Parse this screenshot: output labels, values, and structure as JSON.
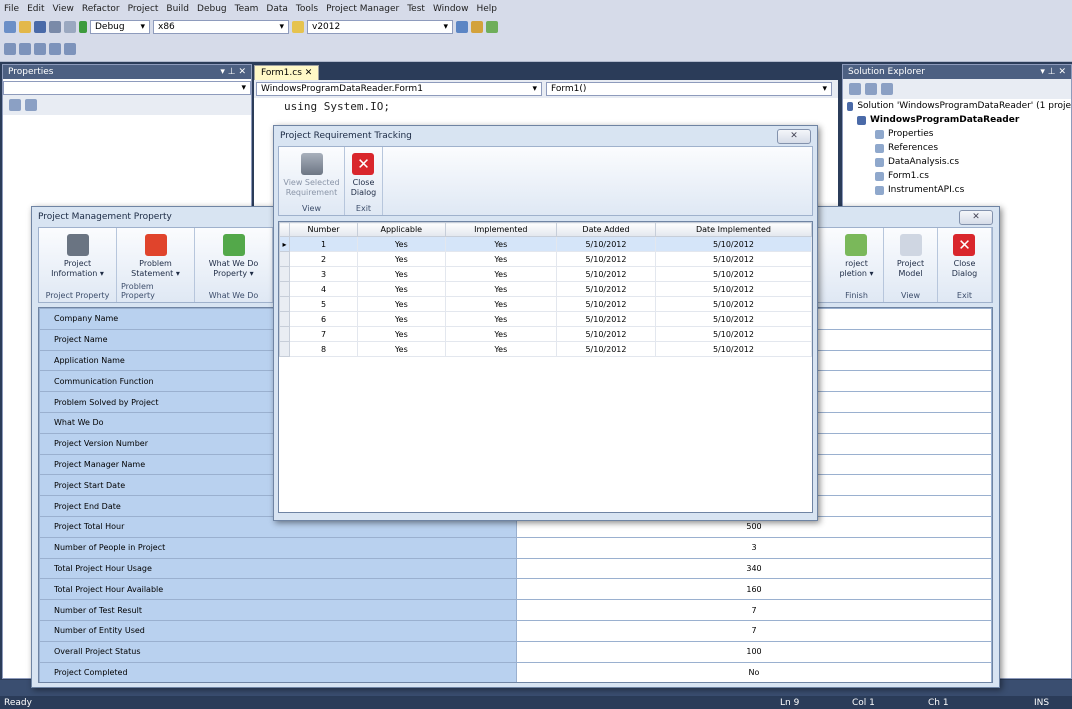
{
  "ide": {
    "menu": [
      "File",
      "Edit",
      "View",
      "Refactor",
      "Project",
      "Build",
      "Debug",
      "Team",
      "Data",
      "Tools",
      "Project Manager",
      "Test",
      "Window",
      "Help"
    ],
    "config": "Debug",
    "platform": "x86",
    "search": "v2012",
    "properties_title": "Properties",
    "editor_tab": "Form1.cs",
    "class_dropdown": "WindowsProgramDataReader.Form1",
    "member_dropdown": "Form1()",
    "code_line": "using System.IO;",
    "solution_explorer_title": "Solution Explorer",
    "solution_tree": [
      "Solution 'WindowsProgramDataReader' (1 proje",
      "WindowsProgramDataReader",
      "Properties",
      "References",
      "DataAnalysis.cs",
      "Form1.cs",
      "InstrumentAPI.cs"
    ],
    "status": {
      "ready": "Ready",
      "ln": "Ln 9",
      "col": "Col 1",
      "ch": "Ch 1",
      "ins": "INS"
    }
  },
  "pm_dialog": {
    "title": "Project Management Property",
    "ribbon_left": [
      {
        "label1": "Project",
        "label2": "Information ▾",
        "group": "Project Property",
        "color": "#6a7482"
      },
      {
        "label1": "Problem",
        "label2": "Statement ▾",
        "group": "Problem Property",
        "color": "#e0442c"
      },
      {
        "label1": "What We Do",
        "label2": "Property ▾",
        "group": "What We Do",
        "color": "#53a84a"
      }
    ],
    "ribbon_right": [
      {
        "label1": "roject",
        "label2": "pletion ▾",
        "group": "Finish"
      },
      {
        "label1": "Project",
        "label2": "Model",
        "group": "View"
      },
      {
        "label1": "Close",
        "label2": "Dialog",
        "group": "Exit"
      }
    ],
    "rows": [
      {
        "label": "Company Name",
        "value": ""
      },
      {
        "label": "Project Name",
        "value": ""
      },
      {
        "label": "Application Name",
        "value": ""
      },
      {
        "label": "Communication Function",
        "value": ""
      },
      {
        "label": "Problem Solved by Project",
        "value": ""
      },
      {
        "label": "What We Do",
        "value": ""
      },
      {
        "label": "Project Version Number",
        "value": ""
      },
      {
        "label": "Project Manager Name",
        "value": ""
      },
      {
        "label": "Project Start Date",
        "value": ""
      },
      {
        "label": "Project End Date",
        "value": ""
      },
      {
        "label": "Project Total Hour",
        "value": "500"
      },
      {
        "label": "Number of People in Project",
        "value": "3"
      },
      {
        "label": "Total Project Hour Usage",
        "value": "340"
      },
      {
        "label": "Total Project Hour Available",
        "value": "160"
      },
      {
        "label": "Number of Test Result",
        "value": "7"
      },
      {
        "label": "Number of Entity Used",
        "value": "7"
      },
      {
        "label": "Overall Project Status",
        "value": "100"
      },
      {
        "label": "Project Completed",
        "value": "No"
      }
    ]
  },
  "req_dialog": {
    "title": "Project Requirement Tracking",
    "ribbon": [
      {
        "label1": "View Selected",
        "label2": "Requirement",
        "group": "View"
      },
      {
        "label1": "Close",
        "label2": "Dialog",
        "group": "Exit"
      }
    ],
    "columns": [
      "Number",
      "Applicable",
      "Implemented",
      "Date Added",
      "Date Implemented"
    ],
    "rows": [
      [
        "1",
        "Yes",
        "Yes",
        "5/10/2012",
        "5/10/2012"
      ],
      [
        "2",
        "Yes",
        "Yes",
        "5/10/2012",
        "5/10/2012"
      ],
      [
        "3",
        "Yes",
        "Yes",
        "5/10/2012",
        "5/10/2012"
      ],
      [
        "4",
        "Yes",
        "Yes",
        "5/10/2012",
        "5/10/2012"
      ],
      [
        "5",
        "Yes",
        "Yes",
        "5/10/2012",
        "5/10/2012"
      ],
      [
        "6",
        "Yes",
        "Yes",
        "5/10/2012",
        "5/10/2012"
      ],
      [
        "7",
        "Yes",
        "Yes",
        "5/10/2012",
        "5/10/2012"
      ],
      [
        "8",
        "Yes",
        "Yes",
        "5/10/2012",
        "5/10/2012"
      ]
    ]
  }
}
